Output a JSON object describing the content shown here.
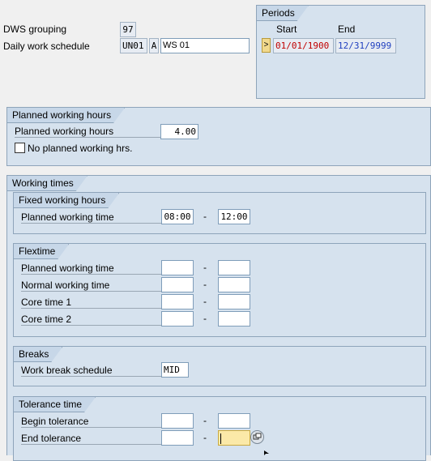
{
  "header": {
    "dws_grouping_label": "DWS grouping",
    "dws_grouping_value": "97",
    "daily_ws_label": "Daily work schedule",
    "daily_ws_code": "UN01",
    "daily_ws_variant": "A",
    "daily_ws_text": "WS 01"
  },
  "periods": {
    "title": "Periods",
    "start_label": "Start",
    "end_label": "End",
    "select_glyph": ">",
    "start": "01/01/1900",
    "end": "12/31/9999"
  },
  "planned": {
    "title": "Planned working hours",
    "hours_label": "Planned working hours",
    "hours_value": "4.00",
    "no_planned_label": "No planned working hrs."
  },
  "working_times": {
    "title": "Working times",
    "fixed": {
      "title": "Fixed working hours",
      "planned_label": "Planned working time",
      "from": "08:00",
      "to": "12:00"
    },
    "flextime": {
      "title": "Flextime",
      "rows": [
        {
          "label": "Planned working time"
        },
        {
          "label": "Normal working time"
        },
        {
          "label": "Core time 1"
        },
        {
          "label": "Core time 2"
        }
      ]
    },
    "breaks": {
      "title": "Breaks",
      "schedule_label": "Work break schedule",
      "schedule_value": "MID"
    },
    "tolerance": {
      "title": "Tolerance time",
      "begin_label": "Begin tolerance",
      "end_label": "End tolerance"
    }
  },
  "dash": "-"
}
